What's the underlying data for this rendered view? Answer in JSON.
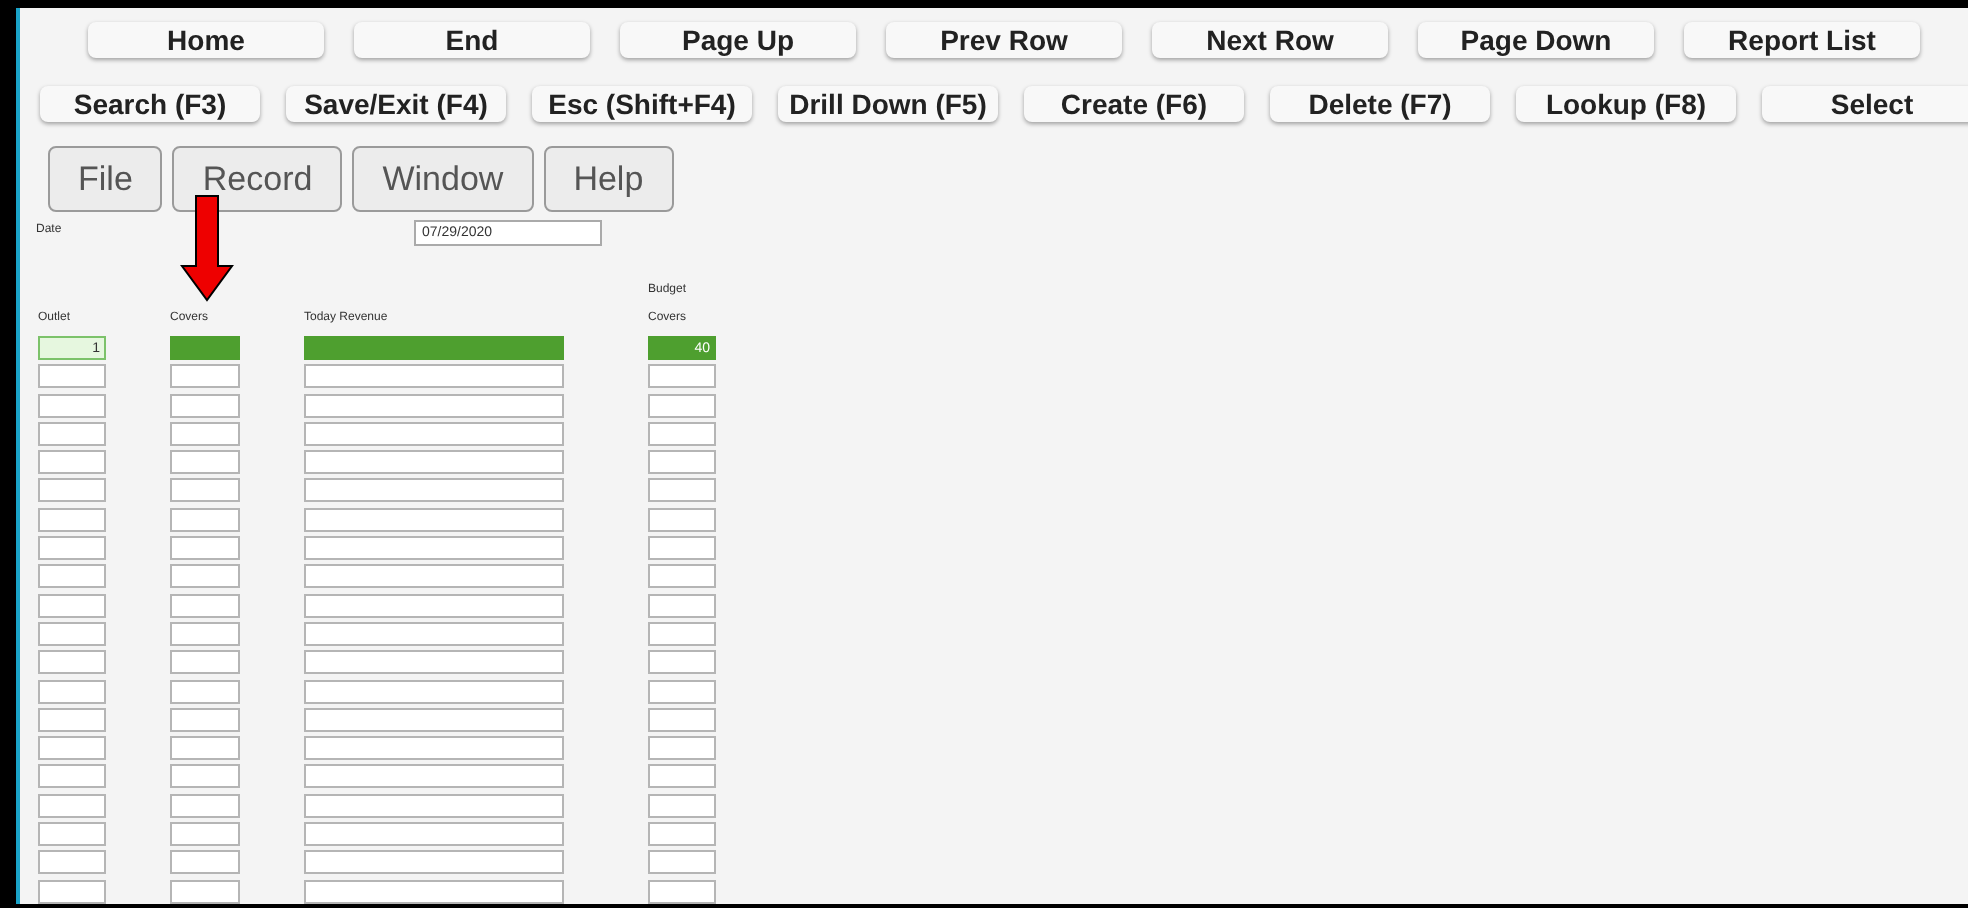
{
  "toolbar_row_1": [
    "Home",
    "End",
    "Page Up",
    "Prev Row",
    "Next Row",
    "Page Down",
    "Report List"
  ],
  "toolbar_row_2": [
    "Search (F3)",
    "Save/Exit (F4)",
    "Esc (Shift+F4)",
    "Drill Down (F5)",
    "Create (F6)",
    "Delete (F7)",
    "Lookup (F8)",
    "Select"
  ],
  "menu": [
    "File",
    "Record",
    "Window",
    "Help"
  ],
  "date": {
    "label": "Date",
    "value": "07/29/2020"
  },
  "table": {
    "columns": [
      {
        "header": "Outlet"
      },
      {
        "header": "Covers"
      },
      {
        "header": "Today Revenue"
      },
      {
        "group": "Budget",
        "header": "Covers"
      }
    ],
    "rows": [
      {
        "selected": true,
        "outlet": "1",
        "budget_covers": "40"
      },
      {
        "selected": false
      },
      {
        "selected": false
      },
      {
        "selected": false
      },
      {
        "selected": false
      },
      {
        "selected": false
      },
      {
        "selected": false
      },
      {
        "selected": false
      },
      {
        "selected": false
      },
      {
        "selected": false
      },
      {
        "selected": false
      },
      {
        "selected": false
      },
      {
        "selected": false
      },
      {
        "selected": false
      },
      {
        "selected": false
      },
      {
        "selected": false
      },
      {
        "selected": false
      },
      {
        "selected": false
      },
      {
        "selected": false
      },
      {
        "selected": false
      }
    ]
  }
}
